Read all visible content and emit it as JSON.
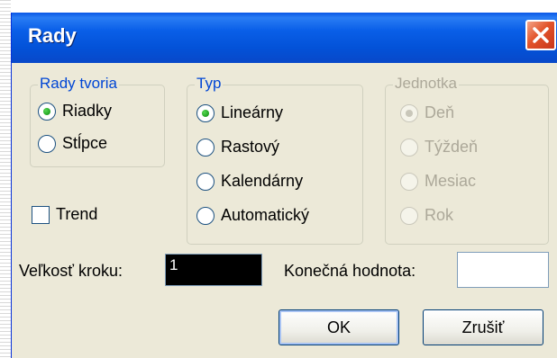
{
  "window": {
    "title": "Rady",
    "close_icon": "close-icon"
  },
  "series_in": {
    "legend": "Rady tvoria",
    "options": [
      {
        "label": "Riadky",
        "selected": true
      },
      {
        "label": "Stĺpce",
        "selected": false
      }
    ]
  },
  "type": {
    "legend": "Typ",
    "options": [
      {
        "label": "Lineárny",
        "selected": true
      },
      {
        "label": "Rastový",
        "selected": false
      },
      {
        "label": "Kalendárny",
        "selected": false
      },
      {
        "label": "Automatický",
        "selected": false
      }
    ]
  },
  "unit": {
    "legend": "Jednotka",
    "disabled": true,
    "options": [
      {
        "label": "Deň",
        "selected": true
      },
      {
        "label": "Týždeň",
        "selected": false
      },
      {
        "label": "Mesiac",
        "selected": false
      },
      {
        "label": "Rok",
        "selected": false
      }
    ]
  },
  "trend": {
    "label": "Trend",
    "checked": false
  },
  "step": {
    "label": "Veľkosť kroku:",
    "value": "1"
  },
  "stop": {
    "label": "Konečná hodnota:",
    "value": ""
  },
  "buttons": {
    "ok": "OK",
    "cancel": "Zrušiť"
  },
  "colors": {
    "titlebar": "#0a5fe8",
    "dialog_bg": "#ece9d8",
    "legend_text": "#0046d5",
    "disabled_text": "#aca899",
    "close_button": "#e2532a",
    "radio_dot": "#21a121"
  }
}
